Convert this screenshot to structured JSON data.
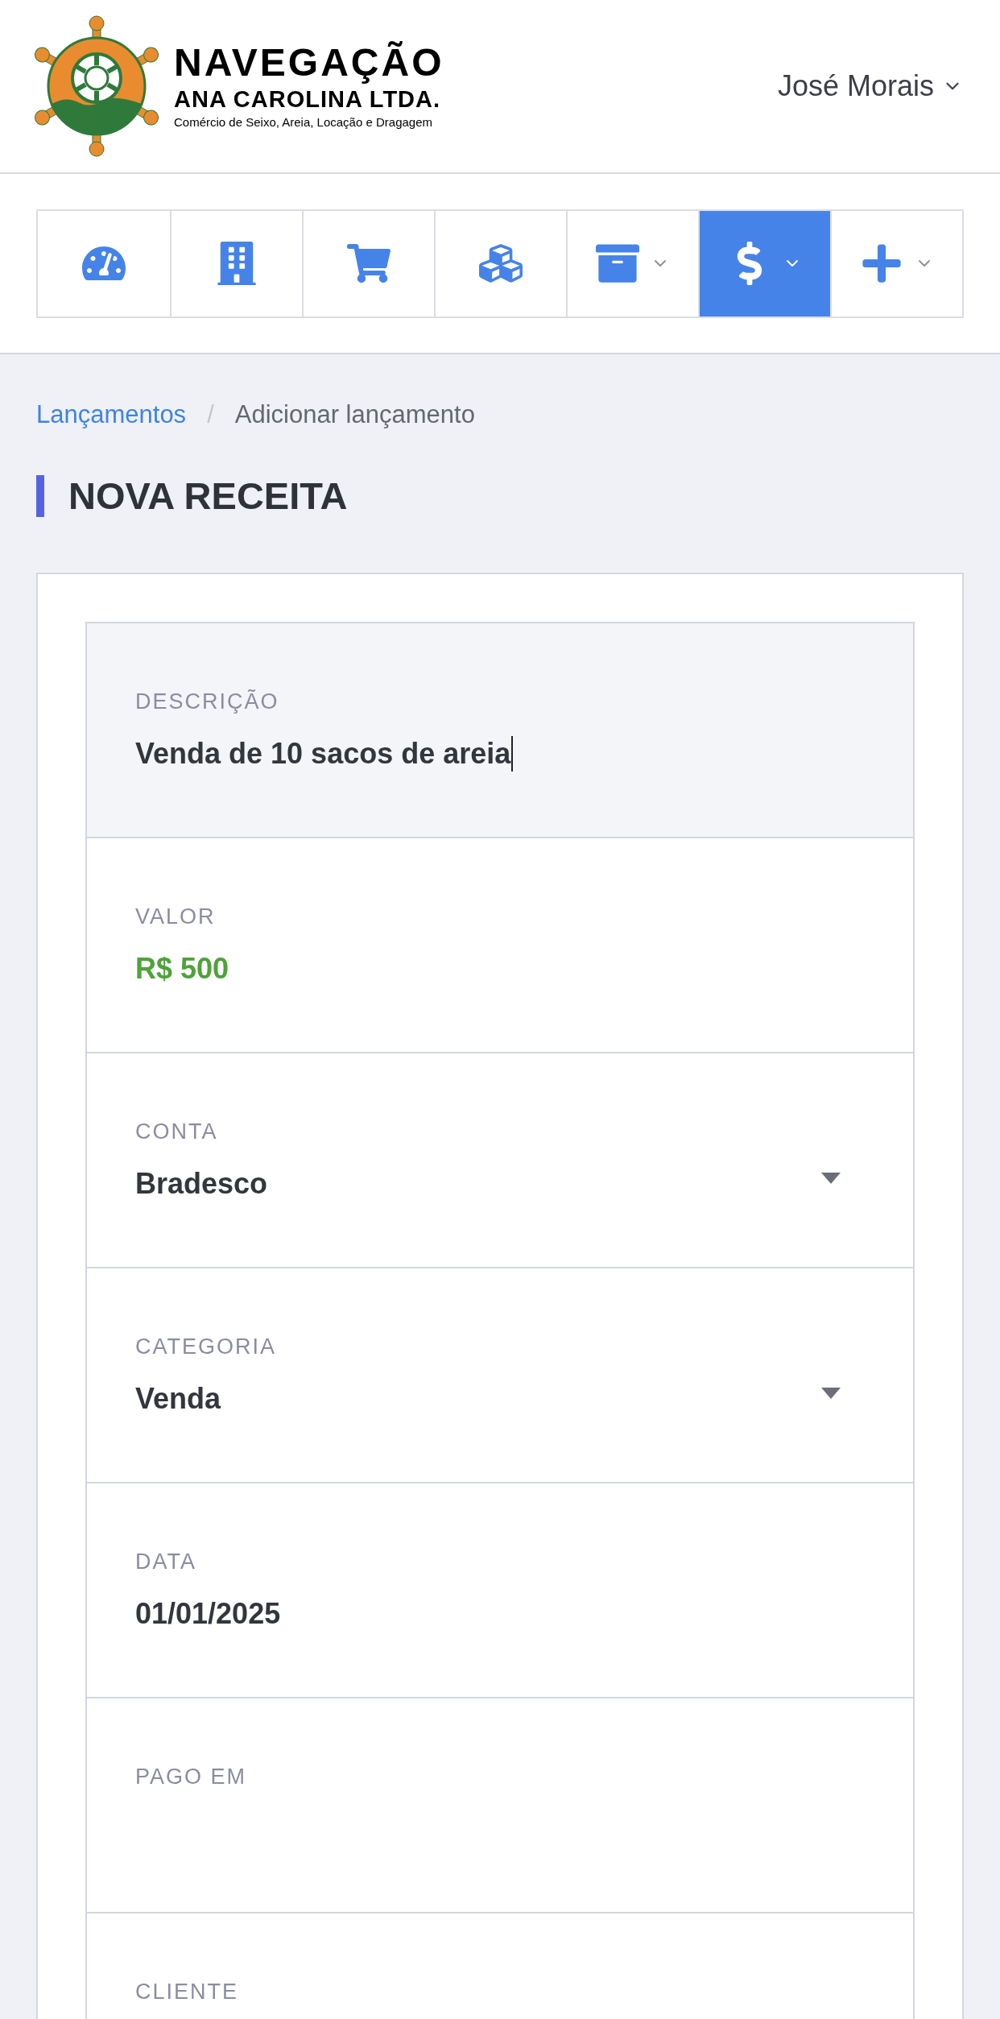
{
  "header": {
    "logo": {
      "title": "NAVEGAÇÃO",
      "subtitle": "ANA CAROLINA LTDA.",
      "tagline": "Comércio de Seixo, Areia, Locação e Dragagem"
    },
    "user": {
      "name": "José Morais"
    }
  },
  "nav": [
    {
      "kind": "dashboard",
      "selected": false,
      "dropdown": false
    },
    {
      "kind": "building",
      "selected": false,
      "dropdown": false
    },
    {
      "kind": "cart",
      "selected": false,
      "dropdown": false
    },
    {
      "kind": "cubes",
      "selected": false,
      "dropdown": false
    },
    {
      "kind": "archive",
      "selected": false,
      "dropdown": true
    },
    {
      "kind": "dollar",
      "selected": true,
      "dropdown": true
    },
    {
      "kind": "plus",
      "selected": false,
      "dropdown": true
    }
  ],
  "breadcrumb": {
    "items": [
      "Lançamentos",
      "Adicionar lançamento"
    ],
    "separator": "/"
  },
  "page_title": "NOVA RECEITA",
  "form": {
    "fields": [
      {
        "label": "DESCRIÇÃO",
        "value": "Venda de 10 sacos de areia",
        "kind": "text",
        "focused": true
      },
      {
        "label": "VALOR",
        "value": "R$ 500",
        "kind": "money"
      },
      {
        "label": "CONTA",
        "value": "Bradesco",
        "kind": "select"
      },
      {
        "label": "CATEGORIA",
        "value": "Venda",
        "kind": "select"
      },
      {
        "label": "DATA",
        "value": "01/01/2025",
        "kind": "text"
      },
      {
        "label": "PAGO EM",
        "kind": "text"
      },
      {
        "label": "CLIENTE",
        "kind": "text"
      }
    ]
  }
}
